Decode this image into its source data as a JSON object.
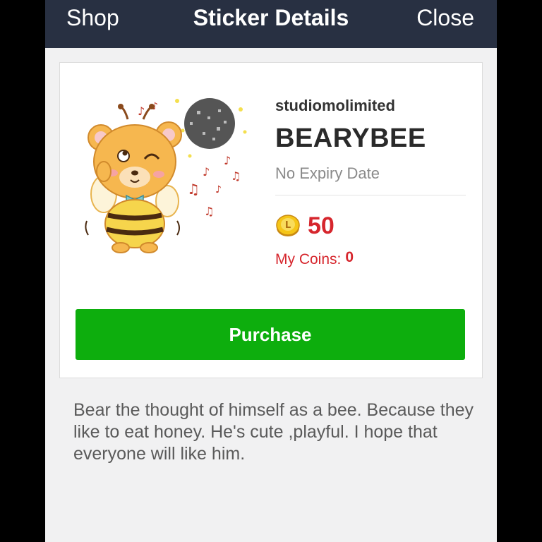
{
  "nav": {
    "left": "Shop",
    "title": "Sticker Details",
    "right": "Close"
  },
  "sticker": {
    "author": "studiomolimited",
    "name": "BEARYBEE",
    "expiry": "No Expiry Date",
    "price": "50",
    "my_coins_label": "My Coins:",
    "my_coins_value": "0",
    "purchase_label": "Purchase",
    "description": "Bear the thought of himself as a bee. Because they like to eat honey. He's cute ,playful. I hope that everyone will like him."
  },
  "colors": {
    "navbar": "#283042",
    "purchase": "#0dae0d",
    "price": "#d6262d"
  },
  "icons": {
    "coin": "line-coin-icon",
    "sticker": "bear-bee-sticker"
  }
}
